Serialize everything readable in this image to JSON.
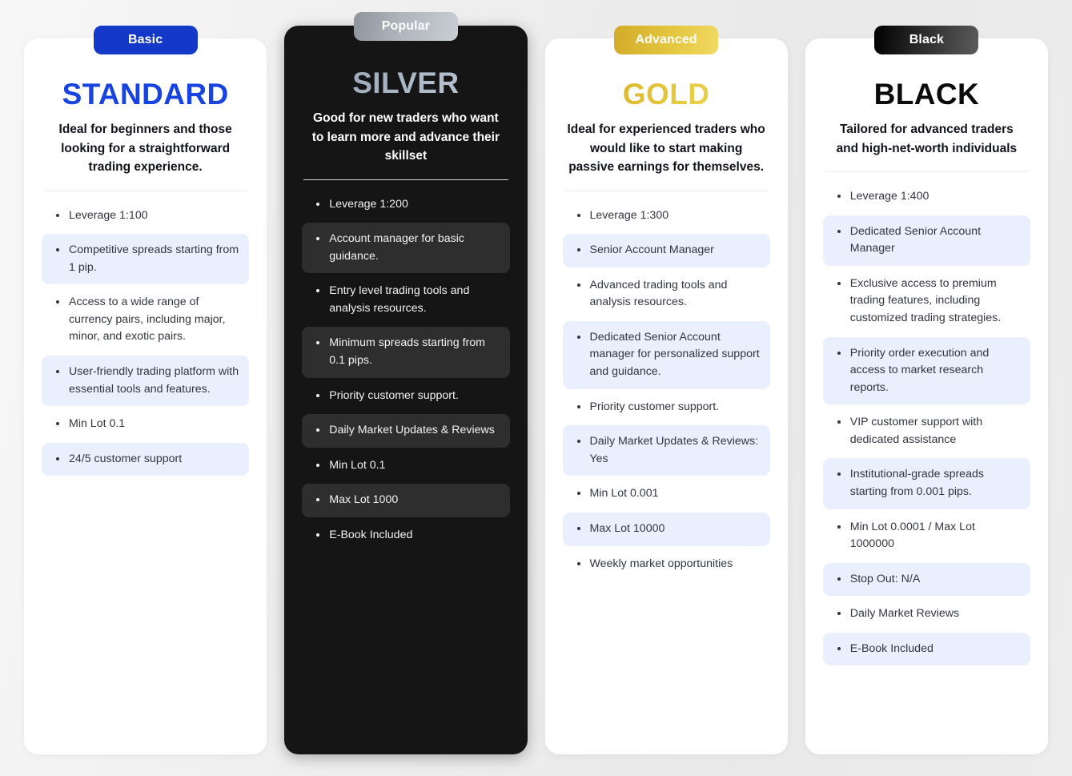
{
  "page": {
    "background_color": "#eeeeee",
    "card_light_bg": "#ffffff",
    "card_dark_bg": "#151515",
    "highlight_light": "#e9effc",
    "highlight_dark": "#2e2e2e"
  },
  "plans": [
    {
      "badge": "Basic",
      "badge_color": "#1438c8",
      "title": "STANDARD",
      "title_color": "#1744e0",
      "description": "Ideal for beginners and those looking for a straightforward trading experience.",
      "theme": "light",
      "features": [
        "Leverage 1:100",
        "Competitive spreads starting from 1 pip.",
        "Access to a wide range of currency pairs, including major, minor, and exotic pairs.",
        "User-friendly trading platform with essential tools and features.",
        "Min Lot 0.1",
        "24/5 customer support"
      ]
    },
    {
      "badge": "Popular",
      "badge_color": "#aeb5bc",
      "title": "SILVER",
      "title_color": "#aab7c5",
      "description": "Good for new traders who want to learn more and advance their skillset",
      "theme": "dark",
      "features": [
        "Leverage 1:200",
        "Account manager for basic guidance.",
        "Entry level trading tools and analysis resources.",
        "Minimum spreads starting from 0.1 pips.",
        "Priority customer support.",
        "Daily Market Updates & Reviews",
        "Min Lot 0.1",
        "Max Lot 1000",
        "E-Book Included"
      ]
    },
    {
      "badge": "Advanced",
      "badge_color": "#e4c640",
      "title": "GOLD",
      "title_color": "#e5c93f",
      "description": "Ideal for experienced traders who would like to start making passive earnings for themselves.",
      "theme": "light",
      "features": [
        "Leverage 1:300",
        "Senior Account Manager",
        "Advanced trading tools and analysis resources.",
        "Dedicated Senior Account manager for personalized support and guidance.",
        "Priority customer support.",
        "Daily Market Updates & Reviews: Yes",
        "Min Lot 0.001",
        "Max Lot 10000",
        "Weekly market opportunities"
      ]
    },
    {
      "badge": "Black",
      "badge_color": "#2b2b2b",
      "title": "BLACK",
      "title_color": "#0b0b0b",
      "description": "Tailored for advanced traders and high-net-worth individuals",
      "theme": "light",
      "features": [
        "Leverage 1:400",
        "Dedicated Senior Account Manager",
        "Exclusive access to premium trading features, including customized trading strategies.",
        "Priority order execution and access to market research reports.",
        "VIP customer support with dedicated assistance",
        "Institutional-grade spreads starting from 0.001 pips.",
        "Min Lot 0.0001 / Max Lot 1000000",
        "Stop Out: N/A",
        "Daily Market Reviews",
        "E-Book Included"
      ]
    }
  ]
}
